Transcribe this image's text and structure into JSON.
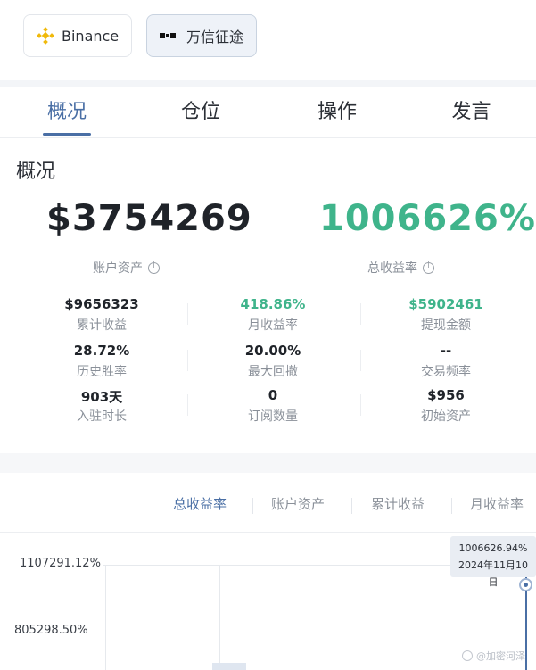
{
  "exchanges": {
    "binance": {
      "label": "Binance",
      "color": "#F0B90B"
    },
    "okx": {
      "label": "万信征途",
      "selected": true
    }
  },
  "tabs": [
    {
      "label": "概况",
      "active": true
    },
    {
      "label": "仓位",
      "active": false
    },
    {
      "label": "操作",
      "active": false
    },
    {
      "label": "发言",
      "active": false
    }
  ],
  "overview": {
    "title": "概况",
    "account_asset": {
      "value": "$3754269",
      "label": "账户资产"
    },
    "total_roi": {
      "value": "1006626%",
      "label": "总收益率"
    },
    "stats": [
      {
        "value": "$9656323",
        "label": "累计收益"
      },
      {
        "value": "418.86%",
        "label": "月收益率",
        "color": "#3FB48B"
      },
      {
        "value": "$5902461",
        "label": "提现金额",
        "color": "#3FB48B"
      },
      {
        "value": "28.72%",
        "label": "历史胜率"
      },
      {
        "value": "20.00%",
        "label": "最大回撤"
      },
      {
        "value": "--",
        "label": "交易频率"
      },
      {
        "value": "903天",
        "label": "入驻时长"
      },
      {
        "value": "0",
        "label": "订阅数量"
      },
      {
        "value": "$956",
        "label": "初始资产"
      }
    ]
  },
  "chart": {
    "tabs": [
      {
        "label": "总收益率",
        "active": true
      },
      {
        "label": "账户资产",
        "active": false
      },
      {
        "label": "累计收益",
        "active": false
      },
      {
        "label": "月收益率",
        "active": false
      }
    ],
    "y_labels": [
      "1107291.12%",
      "805298.50%"
    ],
    "tooltip": {
      "value": "1006626.94%",
      "date": "2024年11月10日"
    }
  },
  "watermark": "@加密河泽",
  "colors": {
    "accent": "#4A6FA5",
    "positive": "#3FB48B"
  }
}
